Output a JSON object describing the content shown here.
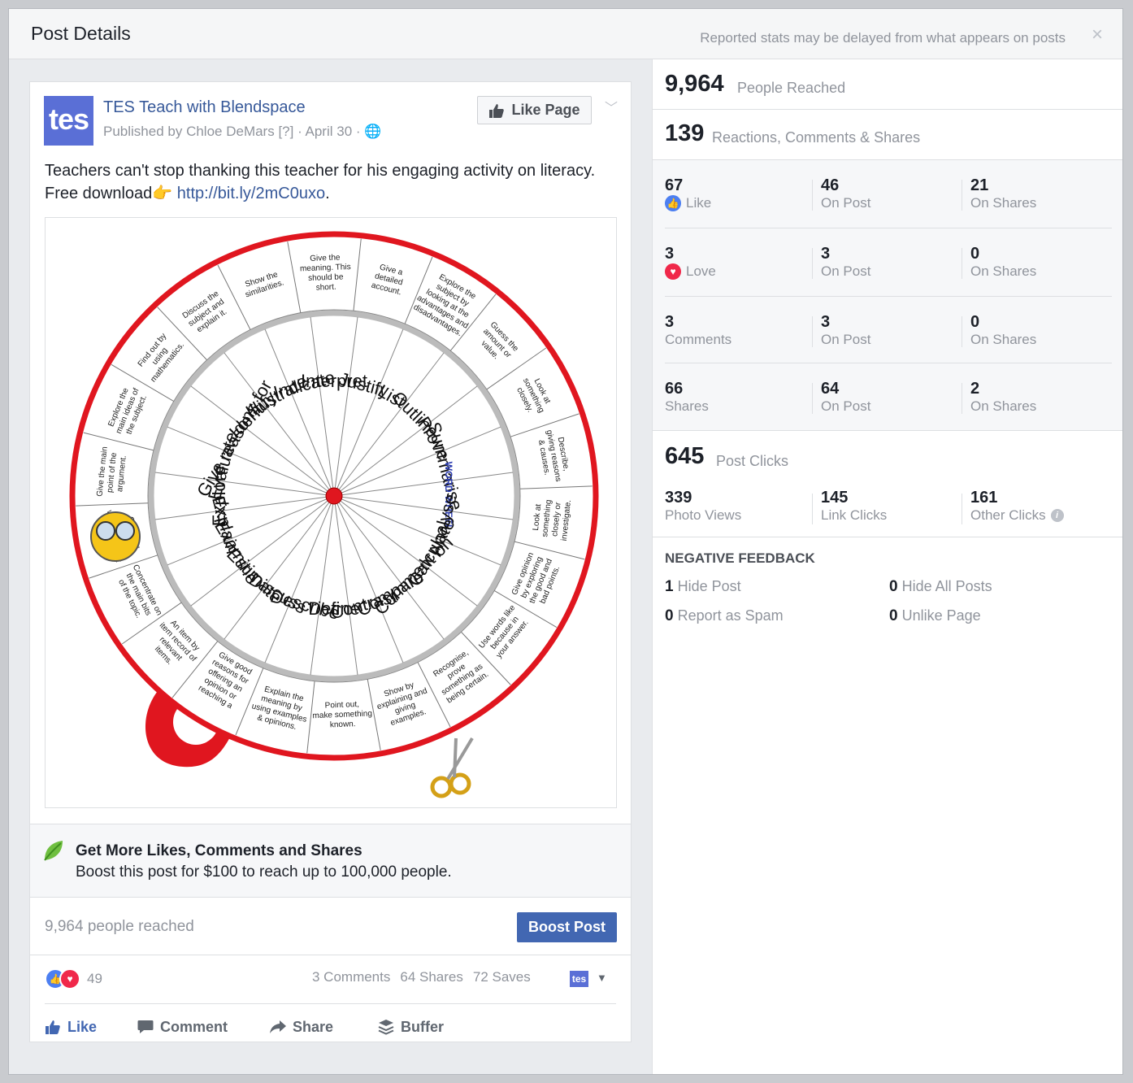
{
  "dialog": {
    "title": "Post Details",
    "note": "Reported stats may be delayed from what appears on posts",
    "close": "×"
  },
  "post": {
    "avatar_text": "tes",
    "page_name": "TES Teach with Blendspace",
    "byline": "Published by Chloe DeMars [?] · April 30 · 🌐",
    "like_page": "Like Page",
    "text": "Teachers can't stop thanking this teacher for his engaging activity on literacy. Free download👉 ",
    "link": "http://bit.ly/2mC0uxo",
    "text_end": ".",
    "wheel": {
      "words": [
        "Interpret",
        "Justify",
        "List",
        "Outline",
        "Prove",
        "Summarise",
        "WORD WHEEL",
        "Analyse",
        "Calculate",
        "Comment on",
        "Compare",
        "Contrast",
        "Define",
        "Describe",
        "Discuss",
        "Estimate",
        "Examine",
        "Explain",
        "Explore",
        "Evaluate",
        "Give reasons for",
        "Identify",
        "Illustrate",
        "Indicate"
      ],
      "outer": [
        "Give a detailed account.",
        "Explore the subject by looking at the advantages and disadvantages.",
        "Guess the amount or value.",
        "Look at something closely.",
        "Describe, giving reasons & causes.",
        "Look at something closely or investigate.",
        "Give opinion by exploring the good and bad points.",
        "Use words like because in your answer.",
        "Recognise, prove something as being certain.",
        "Show by explaining and giving examples.",
        "Point out, make something known.",
        "Explain the meaning by using examples & opinions.",
        "Give good reasons for offering an opinion or reaching a conclusion.",
        "An item by item record of relevant items.",
        "Concentrate on the main bits of the topic.",
        "Give real evidence, which shows it to be true.",
        "Give the main point of the argument.",
        "Explore the main ideas of the subject.",
        "Find out by using mathematics.",
        "Discuss the subject and explain it.",
        "Show the similarities.",
        "Give the meaning. This should be short."
      ]
    }
  },
  "boost_box": {
    "heading": "Get More Likes, Comments and Shares",
    "sub": "Boost this post for $100 to reach up to 100,000 people."
  },
  "footer": {
    "reached": "9,964 people reached",
    "boost_button": "Boost Post",
    "reaction_count": "49",
    "comments": "3 Comments",
    "shares": "64 Shares",
    "saves": "72 Saves",
    "mini_avatar": "tes",
    "actions": [
      "Like",
      "Comment",
      "Share",
      "Buffer"
    ]
  },
  "stats": {
    "reached": {
      "n": "9,964",
      "label": "People Reached"
    },
    "engagement": {
      "n": "139",
      "label": "Reactions, Comments & Shares"
    },
    "rows": [
      [
        {
          "n": "67",
          "t": "Like"
        },
        {
          "n": "46",
          "t": "On Post"
        },
        {
          "n": "21",
          "t": "On Shares"
        }
      ],
      [
        {
          "n": "3",
          "t": "Love"
        },
        {
          "n": "3",
          "t": "On Post"
        },
        {
          "n": "0",
          "t": "On Shares"
        }
      ],
      [
        {
          "n": "3",
          "t": "Comments"
        },
        {
          "n": "3",
          "t": "On Post"
        },
        {
          "n": "0",
          "t": "On Shares"
        }
      ],
      [
        {
          "n": "66",
          "t": "Shares"
        },
        {
          "n": "64",
          "t": "On Post"
        },
        {
          "n": "2",
          "t": "On Shares"
        }
      ]
    ],
    "clicks": {
      "n": "645",
      "label": "Post Clicks"
    },
    "click_rows": [
      {
        "n": "339",
        "t": "Photo Views"
      },
      {
        "n": "145",
        "t": "Link Clicks"
      },
      {
        "n": "161",
        "t": "Other Clicks"
      }
    ],
    "negative": {
      "title": "NEGATIVE FEEDBACK",
      "items": [
        {
          "n": "1",
          "t": "Hide Post"
        },
        {
          "n": "0",
          "t": "Hide All Posts"
        },
        {
          "n": "0",
          "t": "Report as Spam"
        },
        {
          "n": "0",
          "t": "Unlike Page"
        }
      ]
    }
  },
  "colors": {
    "link": "#365899",
    "primary": "#4267b2",
    "muted": "#90949c",
    "wheel_red": "#e0161f"
  }
}
